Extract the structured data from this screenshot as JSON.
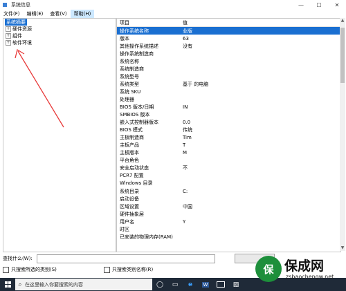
{
  "window": {
    "title": "系统信息"
  },
  "menu": {
    "items": [
      "文件(F)",
      "编辑(E)",
      "查看(V)",
      "帮助(H)"
    ]
  },
  "tree": {
    "items": [
      {
        "label": "系统摘要",
        "expander": ""
      },
      {
        "label": "硬件资源",
        "expander": "+"
      },
      {
        "label": "组件",
        "expander": "+"
      },
      {
        "label": "软件环境",
        "expander": "+"
      }
    ]
  },
  "grid": {
    "headers": [
      "项目",
      "值"
    ],
    "rows": [
      {
        "item": "操作系统名称",
        "value": "业版"
      },
      {
        "item": "版本",
        "value": "63"
      },
      {
        "item": "其他操作系统描述",
        "value": "没有"
      },
      {
        "item": "操作系统制造商",
        "value": ""
      },
      {
        "item": "系统名称",
        "value": ""
      },
      {
        "item": "系统制造商",
        "value": ""
      },
      {
        "item": "系统型号",
        "value": ""
      },
      {
        "item": "系统类型",
        "value": "基于 的电脑"
      },
      {
        "item": "系统 SKU",
        "value": ""
      },
      {
        "item": "处理器",
        "value": ""
      },
      {
        "item": "BIOS 版本/日期",
        "value": "IN"
      },
      {
        "item": "SMBIOS 版本",
        "value": ""
      },
      {
        "item": "嵌入式控制器版本",
        "value": "0.0"
      },
      {
        "item": "BIOS 模式",
        "value": "传统"
      },
      {
        "item": "主板制造商",
        "value": "Tim"
      },
      {
        "item": "主板产品",
        "value": "T"
      },
      {
        "item": "主板版本",
        "value": "M"
      },
      {
        "item": "平台角色",
        "value": ""
      },
      {
        "item": "安全启动状态",
        "value": "不"
      },
      {
        "item": "PCR7 配置",
        "value": ""
      },
      {
        "item": "Windows 目录",
        "value": ""
      },
      {
        "item": "系统目录",
        "value": "C:"
      },
      {
        "item": "启动设备",
        "value": ""
      },
      {
        "item": "区域设置",
        "value": "中国"
      },
      {
        "item": "硬件抽象层",
        "value": ""
      },
      {
        "item": "用户名",
        "value": "Y"
      },
      {
        "item": "时区",
        "value": ""
      },
      {
        "item": "已安装的物理内存(RAM)",
        "value": ""
      }
    ]
  },
  "find": {
    "label": "查找什么(W):",
    "input_value": "",
    "button_label": ""
  },
  "options": {
    "only_selected_category": "只搜索所选的类别(S)",
    "only_category_names": "只搜索类别名称(R)"
  },
  "taskbar": {
    "search_placeholder": "在这里输入你要搜索的内容"
  },
  "watermark": {
    "logo_text": "保",
    "text": "保成网",
    "url": "zsbaochengw.net"
  },
  "colors": {
    "selection": "#1a6fd1",
    "taskbar": "#1f2a38",
    "annotation_arrow": "#e83a3a",
    "watermark_green": "#1d8f3b"
  }
}
